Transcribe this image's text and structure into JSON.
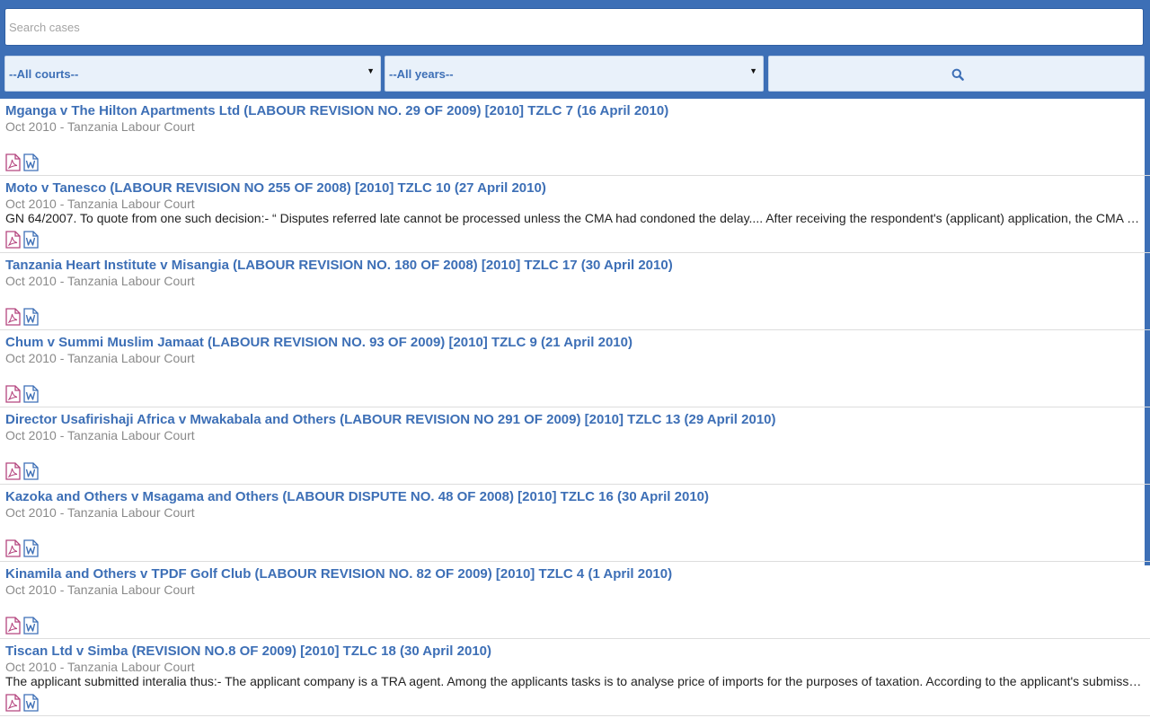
{
  "search": {
    "placeholder": "Search cases"
  },
  "filters": {
    "courts": "--All courts--",
    "years": "--All years--"
  },
  "colors": {
    "brand": "#3d6fb6",
    "pdf": "#b5467f",
    "word": "#3d6fb6"
  },
  "icons": {
    "search_button": "search-icon",
    "pdf": "pdf-file-icon",
    "word": "word-file-icon"
  },
  "results": [
    {
      "title": "Mganga v The Hilton Apartments Ltd (LABOUR REVISION NO. 29 OF 2009) [2010] TZLC 7 (16 April 2010)",
      "meta": "Oct 2010 - Tanzania Labour Court",
      "snippet": ""
    },
    {
      "title": "Moto v Tanesco (LABOUR REVISION NO 255 OF 2008) [2010] TZLC 10 (27 April 2010)",
      "meta": "Oct 2010 - Tanzania Labour Court",
      "snippet": "GN 64/2007. To quote from one such decision:- “ Disputes referred late cannot be processed unless the CMA had condoned the delay.... After receiving the respondent's (applicant) application, the CMA …"
    },
    {
      "title": "Tanzania Heart Institute v Misangia (LABOUR REVISION NO. 180 OF 2008) [2010] TZLC 17 (30 April 2010)",
      "meta": "Oct 2010 - Tanzania Labour Court",
      "snippet": ""
    },
    {
      "title": "Chum v Summi Muslim Jamaat (LABOUR REVISION NO. 93 OF 2009) [2010] TZLC 9 (21 April 2010)",
      "meta": "Oct 2010 - Tanzania Labour Court",
      "snippet": ""
    },
    {
      "title": "Director Usafirishaji Africa v Mwakabala and Others (LABOUR REVISION NO 291 OF 2009) [2010] TZLC 13 (29 April 2010)",
      "meta": "Oct 2010 - Tanzania Labour Court",
      "snippet": ""
    },
    {
      "title": "Kazoka and Others v Msagama and Others (LABOUR DISPUTE NO. 48 OF 2008) [2010] TZLC 16 (30 April 2010)",
      "meta": "Oct 2010 - Tanzania Labour Court",
      "snippet": ""
    },
    {
      "title": "Kinamila and Others v TPDF Golf Club (LABOUR REVISION NO. 82 OF 2009) [2010] TZLC 4 (1 April 2010)",
      "meta": "Oct 2010 - Tanzania Labour Court",
      "snippet": ""
    },
    {
      "title": "Tiscan Ltd v Simba (REVISION NO.8 OF 2009) [2010] TZLC 18 (30 April 2010)",
      "meta": "Oct 2010 - Tanzania Labour Court",
      "snippet": "The applicant submitted interalia thus:- The applicant company is a TRA agent. Among the applicants tasks is to analyse price of imports for the purposes of taxation. According to the applicant's submission …"
    }
  ]
}
